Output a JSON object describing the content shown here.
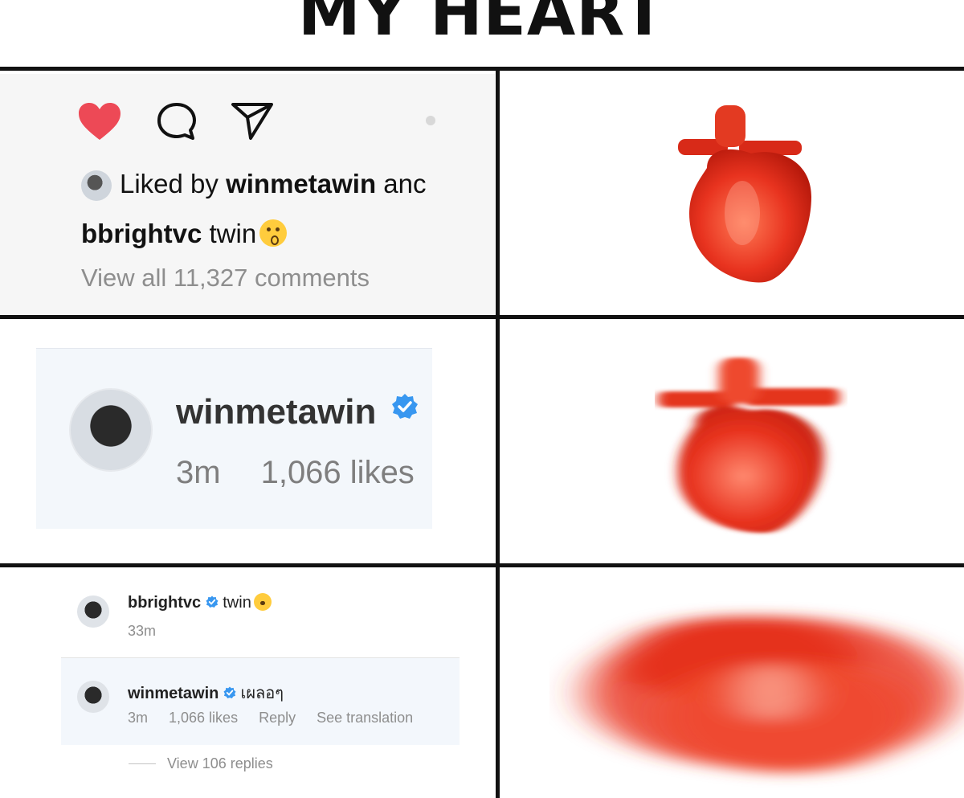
{
  "title": "MY HEART",
  "panel1": {
    "liked_prefix": "Liked by",
    "liked_user": "winmetawin",
    "liked_suffix": "anc",
    "caption_user": "bbrightvc",
    "caption_text": "twin",
    "view_all": "View all 11,327 comments",
    "icons": [
      "heart-icon",
      "comment-icon",
      "share-icon"
    ],
    "heart_color": "#ed4956"
  },
  "panel2": {
    "username": "winmetawin",
    "time": "3m",
    "likes": "1,066 likes",
    "verified_color": "#3897f0"
  },
  "panel3": {
    "comment1": {
      "user": "bbrightvc",
      "text": "twin",
      "time": "33m"
    },
    "comment2": {
      "user": "winmetawin",
      "text": "เผลอๆ",
      "time": "3m",
      "likes": "1,066 likes",
      "reply": "Reply",
      "translate": "See translation"
    },
    "view_replies": "View 106 replies"
  },
  "colors": {
    "heart_red": "#e8331f",
    "text_gray": "#8e8e8e"
  }
}
